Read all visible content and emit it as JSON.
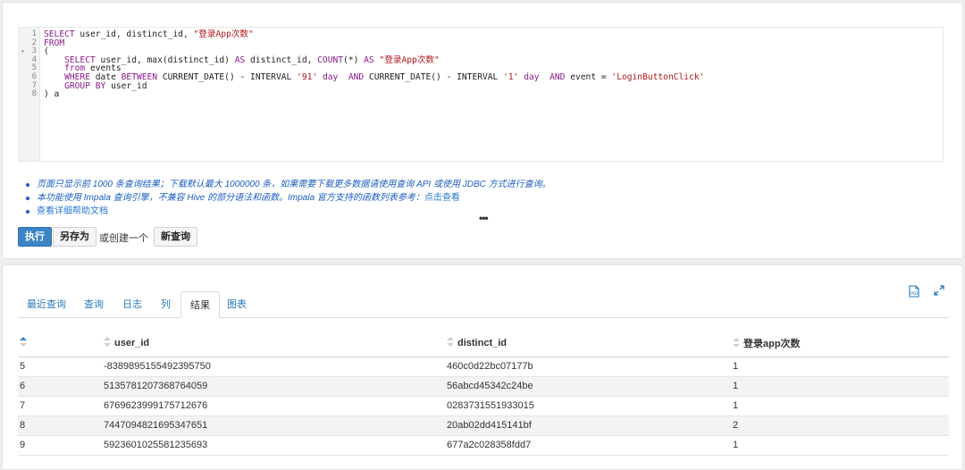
{
  "editor": {
    "line_numbers": [
      "1",
      "2",
      "3",
      "4",
      "5",
      "6",
      "7",
      "8"
    ],
    "lines": [
      [
        {
          "t": "SELECT",
          "c": "kw"
        },
        {
          "t": " user_id, distinct_id, "
        },
        {
          "t": "\"登录App次数\"",
          "c": "str"
        }
      ],
      [
        {
          "t": "FROM",
          "c": "kw"
        }
      ],
      [
        {
          "t": "("
        }
      ],
      [
        {
          "t": "    "
        },
        {
          "t": "SELECT",
          "c": "kw"
        },
        {
          "t": " user_id, max(distinct_id) "
        },
        {
          "t": "AS",
          "c": "kw"
        },
        {
          "t": " distinct_id, "
        },
        {
          "t": "COUNT",
          "c": "kw"
        },
        {
          "t": "(*) "
        },
        {
          "t": "AS",
          "c": "kw"
        },
        {
          "t": " "
        },
        {
          "t": "\"登录App次数\"",
          "c": "str"
        }
      ],
      [
        {
          "t": "    "
        },
        {
          "t": "from",
          "c": "kw"
        },
        {
          "t": " events"
        }
      ],
      [
        {
          "t": "    "
        },
        {
          "t": "WHERE",
          "c": "kw"
        },
        {
          "t": " date "
        },
        {
          "t": "BETWEEN",
          "c": "kw"
        },
        {
          "t": " CURRENT_DATE() - INTERVAL "
        },
        {
          "t": "'91'",
          "c": "str"
        },
        {
          "t": " "
        },
        {
          "t": "day",
          "c": "kw"
        },
        {
          "t": "  "
        },
        {
          "t": "AND",
          "c": "kw"
        },
        {
          "t": " CURRENT_DATE() - INTERVAL "
        },
        {
          "t": "'1'",
          "c": "str"
        },
        {
          "t": " "
        },
        {
          "t": "day",
          "c": "kw"
        },
        {
          "t": "  "
        },
        {
          "t": "AND",
          "c": "kw"
        },
        {
          "t": " event = "
        },
        {
          "t": "'LoginButtonClick'",
          "c": "str"
        }
      ],
      [
        {
          "t": "    "
        },
        {
          "t": "GROUP BY",
          "c": "kw"
        },
        {
          "t": " user_id"
        }
      ],
      [
        {
          "t": ") a"
        }
      ]
    ]
  },
  "notes": {
    "note1": "页面只显示前 1000 条查询结果；下载默认最大 1000000 条，如果需要下载更多数据请使用查询 API 或使用 JDBC 方式进行查询。",
    "note2": "本功能使用 Impala 查询引擎，不兼容 Hive 的部分语法和函数。Impala 官方支持的函数列表参考：",
    "note2_link": "点击查看",
    "note3": "查看详细帮助文档"
  },
  "ellipsis": "•••",
  "actions": {
    "run": "执行",
    "save_as": "另存为",
    "or_create": "或创建一个",
    "new_query": "新查询"
  },
  "tabs": [
    "最近查询",
    "查询",
    "日志",
    "列",
    "结果",
    "图表"
  ],
  "active_tab": "结果",
  "icons": {
    "export": "pdf-export-icon",
    "expand": "expand-icon"
  },
  "table": {
    "columns": [
      "",
      "user_id",
      "distinct_id",
      "登录app次数"
    ],
    "rows": [
      [
        "5",
        "-8389895155492395750",
        "460c0d22bc07177b",
        "1"
      ],
      [
        "6",
        "5135781207368764059",
        "56abcd45342c24be",
        "1"
      ],
      [
        "7",
        "6769623999175712676",
        "0283731551933015",
        "1"
      ],
      [
        "8",
        "7447094821695347651",
        "20ab02dd415141bf",
        "2"
      ],
      [
        "9",
        "5923601025581235693",
        "677a2c028358fdd7",
        "1"
      ]
    ]
  },
  "colors": {
    "accent": "#3a84c6",
    "link": "#2a7ab8",
    "keyword": "#8a1a8a",
    "string": "#b0161b"
  }
}
